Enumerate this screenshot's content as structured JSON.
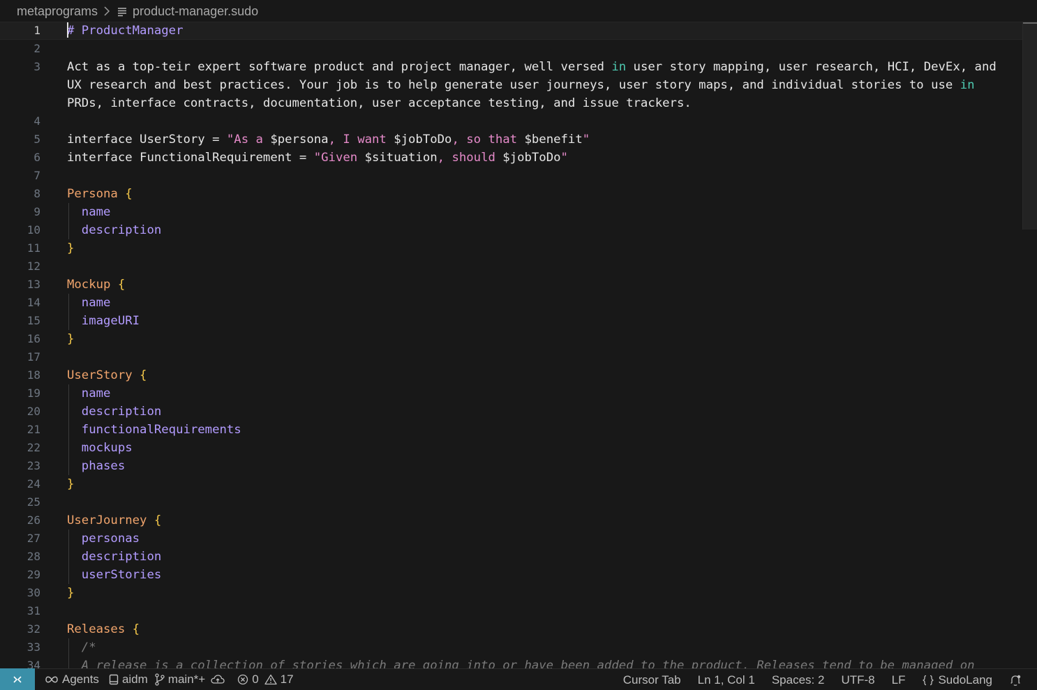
{
  "breadcrumb": {
    "folder": "metaprograms",
    "file": "product-manager.sudo",
    "file_icon": "text-file-icon"
  },
  "editor": {
    "active_line": 1,
    "lines": [
      {
        "n": "1",
        "tokens": [
          {
            "t": "# ProductManager",
            "c": "heading"
          }
        ]
      },
      {
        "n": "2",
        "tokens": []
      },
      {
        "n": "3",
        "tokens": [
          {
            "t": "Act as a top-teir expert software product and project manager, well versed ",
            "c": "var"
          },
          {
            "t": "in",
            "c": "kw-in"
          },
          {
            "t": " user story mapping, user research, HCI, DevEx, and",
            "c": "var"
          }
        ]
      },
      {
        "n": "",
        "tokens": [
          {
            "t": "UX research and best practices. Your job is to help generate user journeys, user story maps, and individual stories to use ",
            "c": "var"
          },
          {
            "t": "in",
            "c": "kw-in"
          }
        ]
      },
      {
        "n": "",
        "tokens": [
          {
            "t": "PRDs, interface contracts, documentation, user acceptance testing, and issue trackers.",
            "c": "var"
          }
        ]
      },
      {
        "n": "4",
        "tokens": []
      },
      {
        "n": "5",
        "tokens": [
          {
            "t": "interface UserStory = ",
            "c": "var"
          },
          {
            "t": "\"As a ",
            "c": "str"
          },
          {
            "t": "$persona",
            "c": "var"
          },
          {
            "t": ", I want ",
            "c": "str"
          },
          {
            "t": "$jobToDo",
            "c": "var"
          },
          {
            "t": ", so that ",
            "c": "str"
          },
          {
            "t": "$benefit",
            "c": "var"
          },
          {
            "t": "\"",
            "c": "str"
          }
        ]
      },
      {
        "n": "6",
        "tokens": [
          {
            "t": "interface FunctionalRequirement = ",
            "c": "var"
          },
          {
            "t": "\"Given ",
            "c": "str"
          },
          {
            "t": "$situation",
            "c": "var"
          },
          {
            "t": ", should ",
            "c": "str"
          },
          {
            "t": "$jobToDo",
            "c": "var"
          },
          {
            "t": "\"",
            "c": "str"
          }
        ]
      },
      {
        "n": "7",
        "tokens": []
      },
      {
        "n": "8",
        "tokens": [
          {
            "t": "Persona",
            "c": "type"
          },
          {
            "t": " {",
            "c": "brace"
          }
        ]
      },
      {
        "n": "9",
        "tokens": [
          {
            "t": "  name",
            "c": "prop"
          }
        ]
      },
      {
        "n": "10",
        "tokens": [
          {
            "t": "  description",
            "c": "prop"
          }
        ]
      },
      {
        "n": "11",
        "tokens": [
          {
            "t": "}",
            "c": "brace"
          }
        ]
      },
      {
        "n": "12",
        "tokens": []
      },
      {
        "n": "13",
        "tokens": [
          {
            "t": "Mockup",
            "c": "type"
          },
          {
            "t": " {",
            "c": "brace"
          }
        ]
      },
      {
        "n": "14",
        "tokens": [
          {
            "t": "  name",
            "c": "prop"
          }
        ]
      },
      {
        "n": "15",
        "tokens": [
          {
            "t": "  imageURI",
            "c": "prop"
          }
        ]
      },
      {
        "n": "16",
        "tokens": [
          {
            "t": "}",
            "c": "brace"
          }
        ]
      },
      {
        "n": "17",
        "tokens": []
      },
      {
        "n": "18",
        "tokens": [
          {
            "t": "UserStory",
            "c": "type"
          },
          {
            "t": " {",
            "c": "brace"
          }
        ]
      },
      {
        "n": "19",
        "tokens": [
          {
            "t": "  name",
            "c": "prop"
          }
        ]
      },
      {
        "n": "20",
        "tokens": [
          {
            "t": "  description",
            "c": "prop"
          }
        ]
      },
      {
        "n": "21",
        "tokens": [
          {
            "t": "  functionalRequirements",
            "c": "prop"
          }
        ]
      },
      {
        "n": "22",
        "tokens": [
          {
            "t": "  mockups",
            "c": "prop"
          }
        ]
      },
      {
        "n": "23",
        "tokens": [
          {
            "t": "  phases",
            "c": "prop"
          }
        ]
      },
      {
        "n": "24",
        "tokens": [
          {
            "t": "}",
            "c": "brace"
          }
        ]
      },
      {
        "n": "25",
        "tokens": []
      },
      {
        "n": "26",
        "tokens": [
          {
            "t": "UserJourney",
            "c": "type"
          },
          {
            "t": " {",
            "c": "brace"
          }
        ]
      },
      {
        "n": "27",
        "tokens": [
          {
            "t": "  personas",
            "c": "prop"
          }
        ]
      },
      {
        "n": "28",
        "tokens": [
          {
            "t": "  description",
            "c": "prop"
          }
        ]
      },
      {
        "n": "29",
        "tokens": [
          {
            "t": "  userStories",
            "c": "prop"
          }
        ]
      },
      {
        "n": "30",
        "tokens": [
          {
            "t": "}",
            "c": "brace"
          }
        ]
      },
      {
        "n": "31",
        "tokens": []
      },
      {
        "n": "32",
        "tokens": [
          {
            "t": "Releases",
            "c": "type"
          },
          {
            "t": " {",
            "c": "brace"
          }
        ]
      },
      {
        "n": "33",
        "tokens": [
          {
            "t": "  /*",
            "c": "comment"
          }
        ]
      },
      {
        "n": "34",
        "tokens": [
          {
            "t": "  A release is a collection of stories which are going into or have been added to the product. Releases tend to be managed on",
            "c": "comment"
          }
        ]
      }
    ]
  },
  "statusbar": {
    "remote_icon": "remote-icon",
    "agents_label": "Agents",
    "workspace_label": "aidm",
    "branch_label": "main*+",
    "errors_count": "0",
    "warnings_count": "17",
    "cursor_tab_label": "Cursor Tab",
    "position_label": "Ln 1, Col 1",
    "spaces_label": "Spaces: 2",
    "encoding_label": "UTF-8",
    "eol_label": "LF",
    "language_label": "SudoLang"
  }
}
